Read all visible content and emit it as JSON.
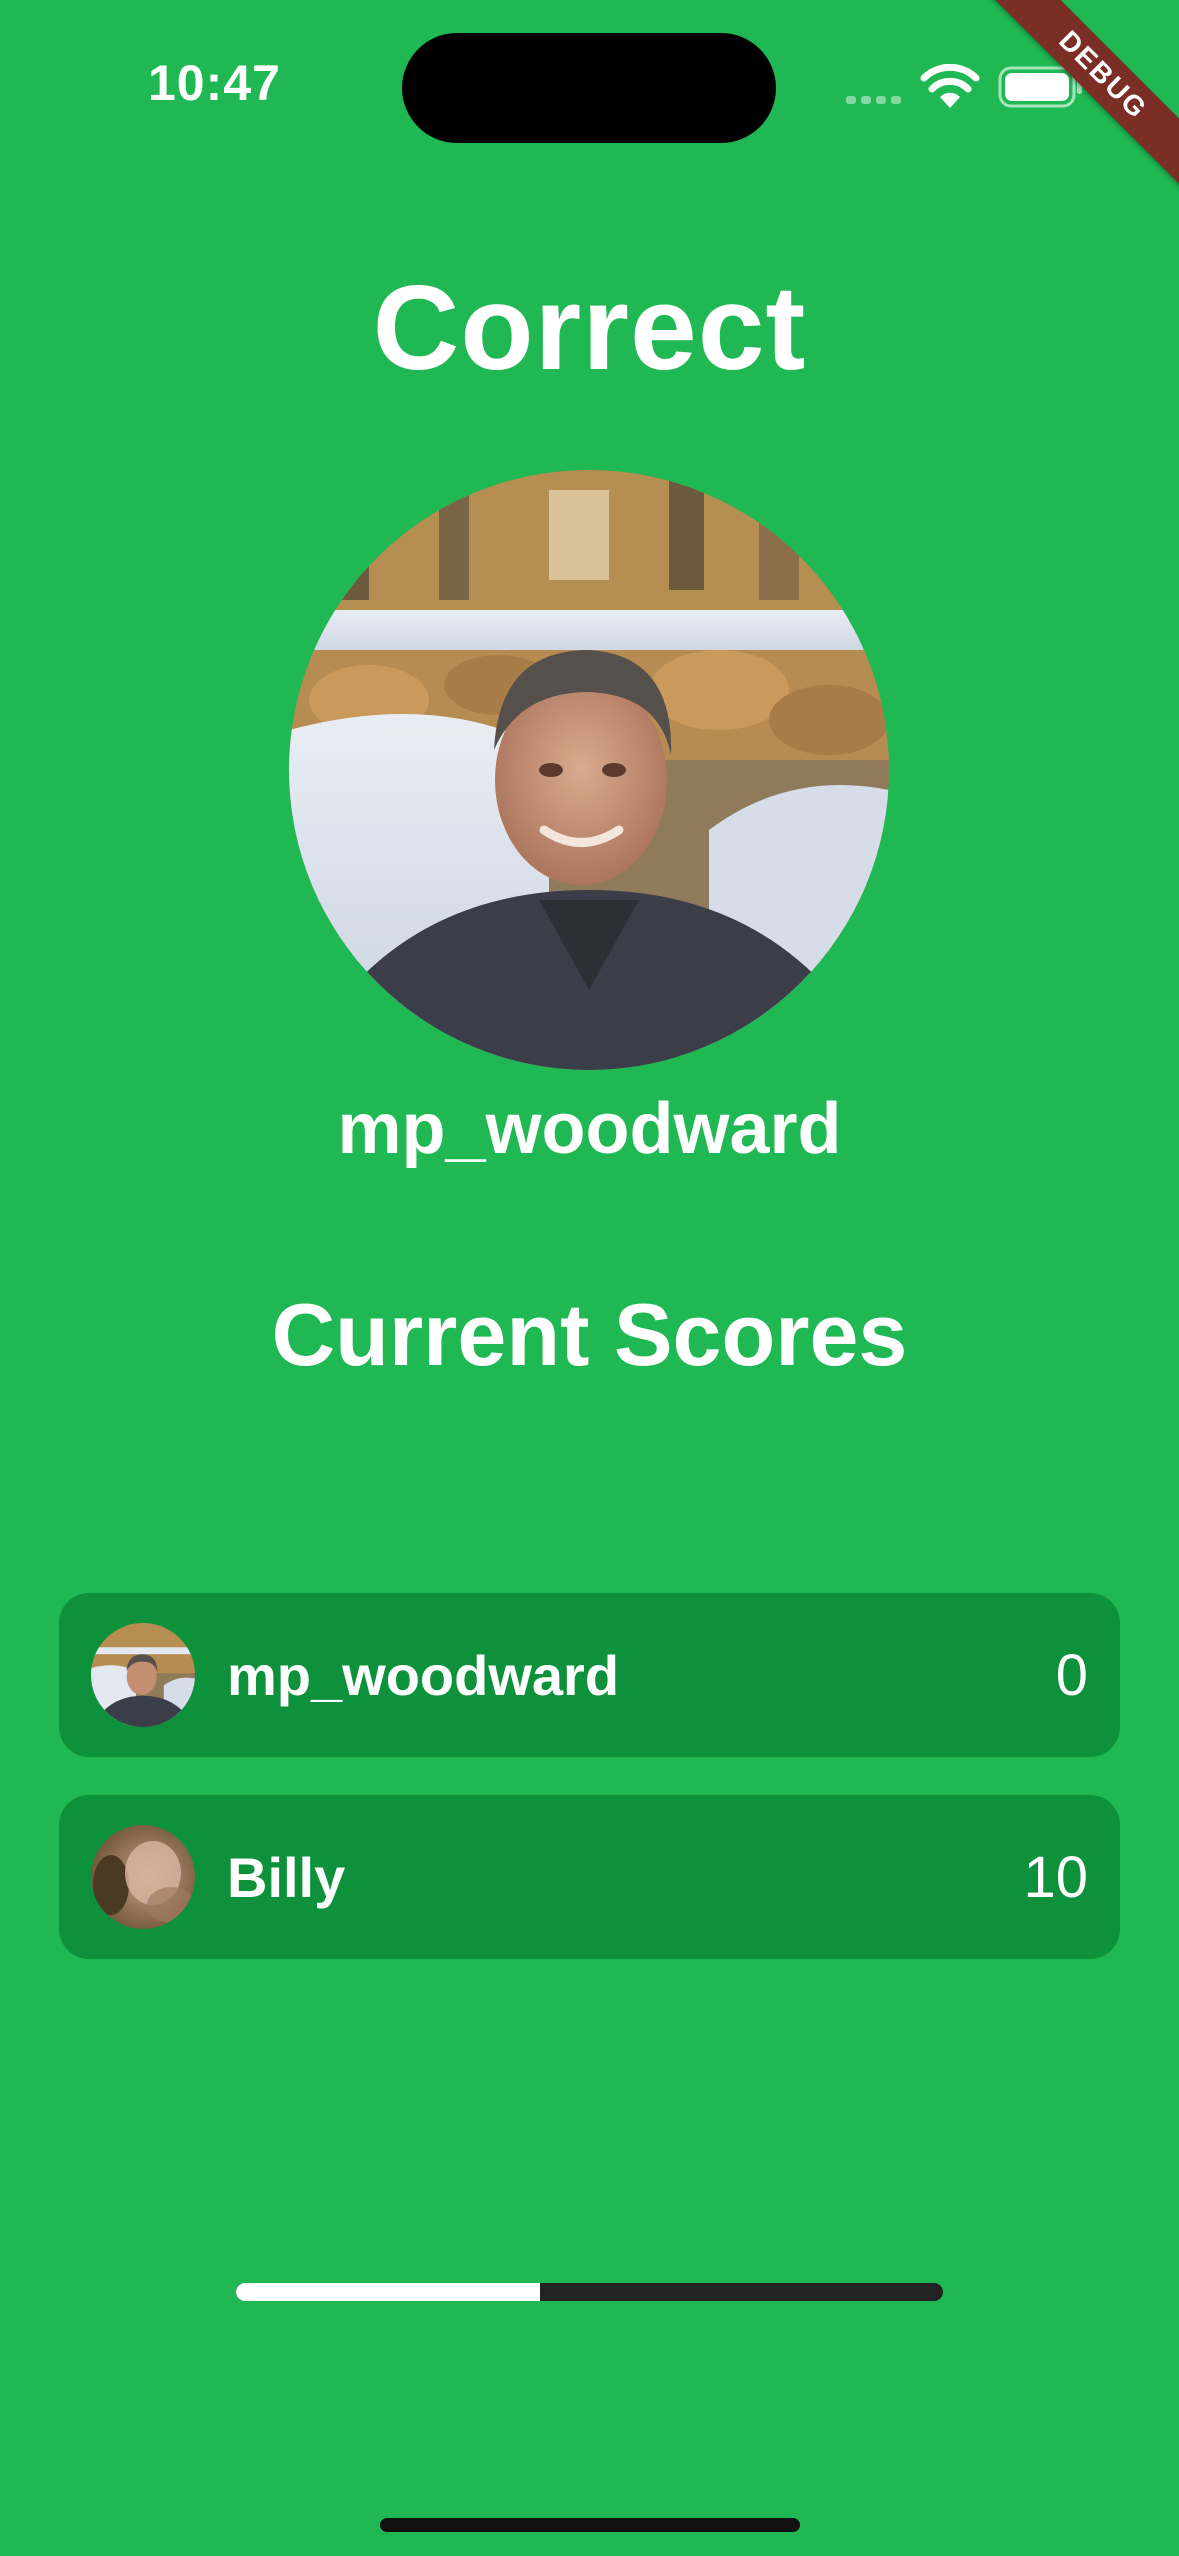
{
  "status_bar": {
    "time": "10:47",
    "icons": [
      "signal-icon",
      "wifi-icon",
      "battery-icon"
    ]
  },
  "debug_banner": {
    "label": "DEBUG",
    "color": "#7a2e26"
  },
  "result": {
    "title": "Correct",
    "winner_name": "mp_woodward",
    "avatar": "profile-photo"
  },
  "scores": {
    "heading": "Current Scores",
    "players": [
      {
        "name": "mp_woodward",
        "score": "0",
        "avatar": "profile-photo"
      },
      {
        "name": "Billy",
        "score": "10",
        "avatar": "profile-photo"
      }
    ]
  },
  "timer": {
    "progress": 0.43
  },
  "colors": {
    "background": "#1fb853",
    "row_background": "#0e913b",
    "progress_fill": "#ffffff",
    "progress_track": "#232323"
  }
}
